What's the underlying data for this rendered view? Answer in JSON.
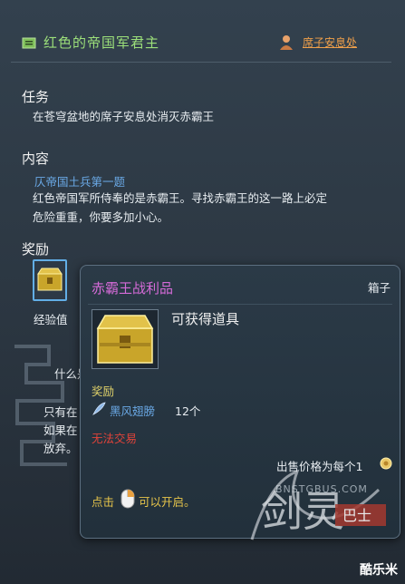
{
  "quest": {
    "title": "红色的帝国军君主",
    "npc_link": "席子安息处",
    "task_heading": "任务",
    "task_text": "在苍穹盆地的席子安息处消灭赤霸王",
    "content_heading": "内容",
    "content_sublink": "仄帝国土兵第一题",
    "content_text_1": "红色帝国军所侍奉的是赤霸王。寻找赤霸王的这一路上必定",
    "content_text_2": "危险重重，你要多加小心。",
    "reward_heading": "奖励",
    "exp_label": "经验值",
    "hint_1": "什么是",
    "hint_2": "只有在",
    "hint_3": "如果在",
    "hint_4": "放弃。"
  },
  "tooltip": {
    "item_name": "赤霸王战利品",
    "item_type": "箱子",
    "description": "可获得道具",
    "reward_heading": "奖励",
    "reward_item": "黑风翅膀",
    "reward_count": "12个",
    "untradeable": "无法交易",
    "sell_price": "出售价格为每个1",
    "click_prefix": "点击",
    "click_suffix": "可以开启。"
  },
  "watermark": {
    "url": "BNSTGBUS.COM",
    "logo_text": "剑灵",
    "logo_sub": "巴士",
    "brand": "酷乐米"
  },
  "icons": {
    "quest": "quest-scroll-icon",
    "npc": "npc-location-icon",
    "chest": "treasure-chest-icon",
    "feather": "feather-icon",
    "coin": "coin-icon",
    "mouse": "mouse-right-click-icon"
  },
  "colors": {
    "quest_title": "#9ce07a",
    "npc_link": "#f0a04a",
    "item_name": "#d56bd8",
    "untradeable": "#e0433a",
    "sublink": "#6aa9e6",
    "reward_heading": "#e0d26a"
  }
}
